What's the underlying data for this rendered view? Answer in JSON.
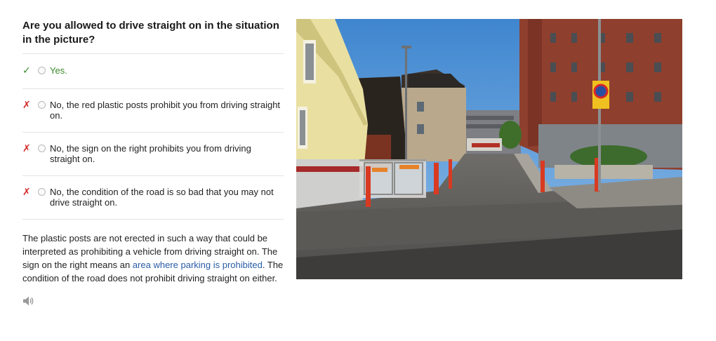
{
  "question": "Are you allowed to drive straight on in the situation in the picture?",
  "answers": [
    {
      "text": "Yes.",
      "correct": true
    },
    {
      "text": "No, the red plastic posts prohibit you from driving straight on.",
      "correct": false
    },
    {
      "text": "No, the sign on the right prohibits you from driving straight on.",
      "correct": false
    },
    {
      "text": "No, the condition of the road is so bad that you may not drive straight on.",
      "correct": false
    }
  ],
  "marks": {
    "correct": "✓",
    "wrong": "✗"
  },
  "explanation": {
    "before": "The plastic posts are not erected in such a way that could be interpreted as prohibiting a vehicle from driving straight on. The sign on the right means an ",
    "link": "area where parking is prohibited",
    "after": ". The condition of the road does not prohibit driving straight on either."
  },
  "speaker_icon": "speaker-icon",
  "colors": {
    "correct": "#3a8a2a",
    "wrong": "#d22a2a",
    "link": "#2a5ca8"
  }
}
